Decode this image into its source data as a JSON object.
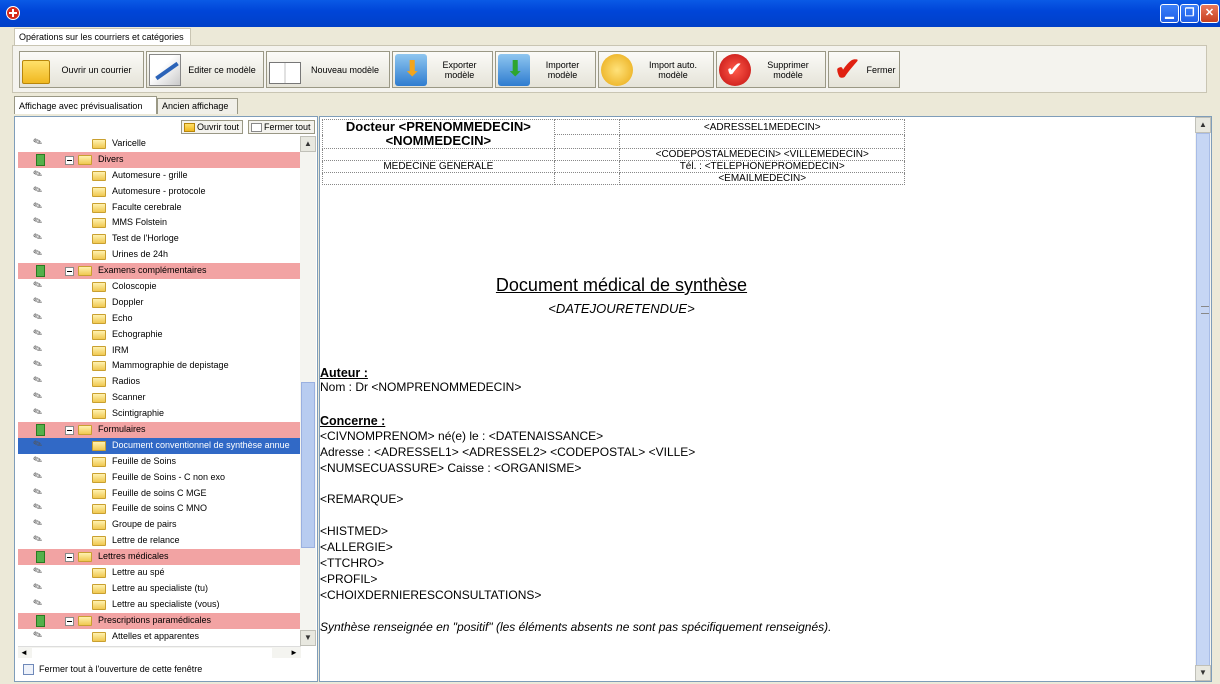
{
  "window": {
    "title": "",
    "buttons": {
      "minimize": "▁",
      "maximize": "❐",
      "close": "✕"
    }
  },
  "menu": {
    "tab": "Opérations sur les courriers et catégories"
  },
  "toolbar": {
    "open": "Ouvrir un courrier",
    "edit": "Editer ce modèle",
    "new": "Nouveau modèle",
    "export": "Exporter modèle",
    "import": "Importer modèle",
    "auto_import": "Import auto. modèle",
    "delete": "Supprimer modèle",
    "close": "Fermer"
  },
  "tabs": {
    "preview": "Affichage avec prévisualisation",
    "old": "Ancien affichage"
  },
  "left": {
    "open_all": "Ouvrir tout",
    "close_all": "Fermer tout",
    "footer_checkbox": "Fermer tout à l'ouverture de cette fenêtre",
    "tree": [
      {
        "type": "item",
        "label": "Varicelle"
      },
      {
        "type": "cat",
        "label": "Divers"
      },
      {
        "type": "item",
        "label": "Automesure - grille"
      },
      {
        "type": "item",
        "label": "Automesure - protocole"
      },
      {
        "type": "item",
        "label": "Faculte cerebrale"
      },
      {
        "type": "item",
        "label": "MMS Folstein"
      },
      {
        "type": "item",
        "label": "Test de l'Horloge"
      },
      {
        "type": "item",
        "label": "Urines de 24h"
      },
      {
        "type": "cat",
        "label": "Examens complémentaires"
      },
      {
        "type": "item",
        "label": "Coloscopie"
      },
      {
        "type": "item",
        "label": "Doppler"
      },
      {
        "type": "item",
        "label": "Echo"
      },
      {
        "type": "item",
        "label": "Echographie"
      },
      {
        "type": "item",
        "label": "IRM"
      },
      {
        "type": "item",
        "label": "Mammographie de depistage"
      },
      {
        "type": "item",
        "label": "Radios"
      },
      {
        "type": "item",
        "label": "Scanner"
      },
      {
        "type": "item",
        "label": "Scintigraphie"
      },
      {
        "type": "cat",
        "label": "Formulaires"
      },
      {
        "type": "sel",
        "label": "Document conventionnel de synthèse annue"
      },
      {
        "type": "item",
        "label": "Feuille de Soins"
      },
      {
        "type": "item",
        "label": "Feuille de Soins - C non exo"
      },
      {
        "type": "item",
        "label": "Feuille de soins C MGE"
      },
      {
        "type": "item",
        "label": "Feuille de soins C MNO"
      },
      {
        "type": "item",
        "label": "Groupe de pairs"
      },
      {
        "type": "item",
        "label": "Lettre de relance"
      },
      {
        "type": "cat",
        "label": "Lettres médicales"
      },
      {
        "type": "item",
        "label": "Lettre au spé"
      },
      {
        "type": "item",
        "label": "Lettre au specialiste (tu)"
      },
      {
        "type": "item",
        "label": "Lettre au specialiste (vous)"
      },
      {
        "type": "cat",
        "label": "Prescriptions paramédicales"
      },
      {
        "type": "item",
        "label": "Attelles et apparentes"
      }
    ]
  },
  "doc": {
    "header": {
      "doctor_name": "Docteur <PRENOMMEDECIN> <NOMMEDECIN>",
      "address1": "<ADRESSEL1MEDECIN>",
      "postal_city": "<CODEPOSTALMEDECIN> <VILLEMEDECIN>",
      "specialty": "MEDECINE GENERALE",
      "phone": "Tél. : <TELEPHONEPROMEDECIN>",
      "email": "<EMAILMEDECIN>"
    },
    "title": "Document médical de synthèse",
    "date": "<DATEJOURETENDUE>",
    "author_heading": "Auteur :",
    "author_line": "Nom : Dr <NOMPRENOMMEDECIN>",
    "concerns_heading": "Concerne :",
    "concerns_line1": "<CIVNOMPRENOM> né(e) le : <DATENAISSANCE>",
    "concerns_line2": "Adresse : <ADRESSEL1>  <ADRESSEL2>  <CODEPOSTAL> <VILLE>",
    "concerns_line3": "<NUMSECUASSURE>  Caisse : <ORGANISME>",
    "remark": "<REMARQUE>",
    "histmed": "<HISTMED>",
    "allergie": "<ALLERGIE>",
    "ttchro": "<TTCHRO>",
    "profil": "<PROFIL>",
    "choix": "<CHOIXDERNIERESCONSULTATIONS>",
    "note": "Synthèse renseignée en \"positif\" (les éléments absents ne sont pas spécifiquement renseignés)."
  }
}
